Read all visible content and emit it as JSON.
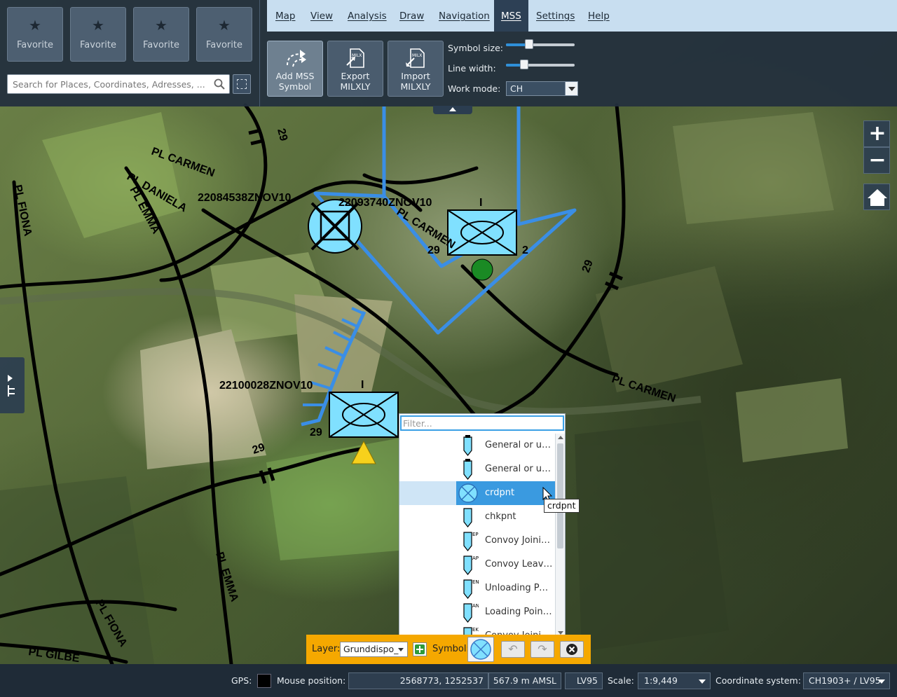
{
  "favorites": [
    {
      "label": "Favorite"
    },
    {
      "label": "Favorite"
    },
    {
      "label": "Favorite"
    },
    {
      "label": "Favorite"
    }
  ],
  "search": {
    "placeholder": "Search for Places, Coordinates, Adresses, ..."
  },
  "menu": [
    "Map",
    "View",
    "Analysis",
    "Draw",
    "Navigation",
    "MSS",
    "Settings",
    "Help"
  ],
  "menu_active": "MSS",
  "toolbar": {
    "add_mss": "Add MSS\nSymbol",
    "add_mss_l1": "Add MSS",
    "add_mss_l2": "Symbol",
    "export_l1": "Export",
    "export_l2": "MILXLY",
    "import_l1": "Import",
    "import_l2": "MILXLY",
    "milx_badge": "MILX",
    "symbol_size_label": "Symbol size:",
    "line_width_label": "Line width:",
    "work_mode_label": "Work mode:",
    "work_mode_value": "CH",
    "symbol_size_level": 0.34,
    "line_width_level": 0.27
  },
  "map_labels": {
    "pl_carmen_1": "PL CARMEN",
    "pl_carmen_2": "PL CARMEN",
    "pl_carmen_3": "PL CARMEN",
    "pl_daniela": "PL DANIELA",
    "pl_emma_1": "PL EMMA",
    "pl_emma_2": "PL EMMA",
    "pl_fiona_1": "PL FIONA",
    "pl_fiona_2": "PL FIONA",
    "pl_gil": "PL GILBE",
    "dtg_1": "22084538ZNOV10",
    "dtg_2": "22093740ZNOV10",
    "dtg_3": "22100028ZNOV10",
    "n29_a": "29",
    "n29_b": "29",
    "n29_c": "29",
    "n29_d": "29",
    "n29_e": "29",
    "n1_a": "I",
    "n1_b": "I",
    "n2": "2"
  },
  "picker": {
    "filter_placeholder": "Filter...",
    "items": [
      {
        "label": "General or un...",
        "badge": ""
      },
      {
        "label": "General or un...",
        "badge": ""
      },
      {
        "label": "crdpnt",
        "badge": ""
      },
      {
        "label": "chkpnt",
        "badge": ""
      },
      {
        "label": "Convoy Joinin...",
        "badge": "EP"
      },
      {
        "label": "Convoy Leavi...",
        "badge": "AP"
      },
      {
        "label": "Unloading Poi...",
        "badge": "ENP"
      },
      {
        "label": "Loading Point ...",
        "badge": "ANP"
      },
      {
        "label": "Convoy Joinin...",
        "badge": "EKP"
      }
    ],
    "selected_index": 2,
    "tooltip": "crdpnt"
  },
  "drawbar": {
    "layer_label": "Layer:",
    "layer_value": "Grunddispo_",
    "symbol_label": "Symbol:"
  },
  "status": {
    "gps_label": "GPS:",
    "mouse_label": "Mouse position:",
    "mouse_value": "2568773, 1252537",
    "altitude": "567.9 m AMSL",
    "projection": "LV95",
    "scale_label": "Scale:",
    "scale_value": "1:9,449",
    "crs_label": "Coordinate system:",
    "crs_value": "CH1903+ / LV95"
  },
  "colors": {
    "friendly_fill": "#80e0ff",
    "route_blue": "#3a8ee6",
    "accent": "#f5a800",
    "menubar": "#c8def0"
  }
}
